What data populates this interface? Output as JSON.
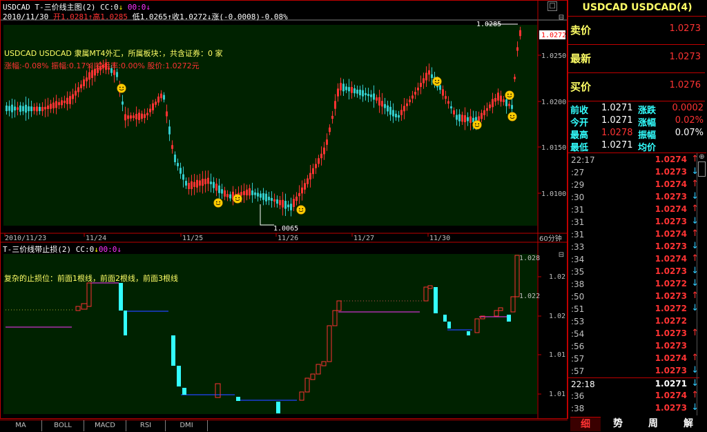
{
  "symbol_title": "USDCAD  USDCAD(4)",
  "main_chart": {
    "title": "USDCAD  T-三价线主图(2)",
    "cc_label": "CC:0",
    "cc_arrow": "↓",
    "cc_time": "00:0",
    "cc_time_arrow": "↓",
    "bar_info": {
      "date": "2010/11/30",
      "open": "开1.0281",
      "open_arrow": "↑",
      "high": "高1.0285",
      "low": "低1.0265",
      "low_arrow": "↑",
      "close": "收1.0272",
      "close_arrow": "↓",
      "change": "涨(-0.0008)-0.08%"
    },
    "info_line1": "USDCAD  USDCAD  隶属MT4外汇，所属板块：，共含证券：0 家",
    "info_line2": "涨幅:-0.08% 振幅:0.17% 换手率:0.00% 股价:1.0272元",
    "price_axis": [
      "1.0250",
      "1.0200",
      "1.0150",
      "1.0100"
    ],
    "current_price_label": "1.0272",
    "high_marker": "1.0285",
    "low_marker": "1.0065",
    "date_axis": [
      "2010/11/23",
      "11/24",
      "11/25",
      "11/26",
      "11/27",
      "11/30"
    ],
    "period_label": "60分钟"
  },
  "sub_chart": {
    "title": "T-三价线带止损(2)",
    "cc_label": "CC:0",
    "cc_arrow": "↓",
    "cc_time": "00:0",
    "cc_time_arrow": "↓",
    "info_line": "复杂的止损位：前面1根线，前面2根线，前面3根线",
    "axis_labels": [
      "1.028",
      "1.02",
      "1.022",
      "1.02",
      "1.01",
      "1.01"
    ]
  },
  "quote_panel": {
    "sell": {
      "label": "卖价",
      "value": "1.0273"
    },
    "last": {
      "label": "最新",
      "value": "1.0273"
    },
    "buy": {
      "label": "买价",
      "value": "1.0276"
    },
    "stats": [
      {
        "l1": "前收",
        "v1": "1.0271",
        "l2": "涨跌",
        "v2": "0.0002"
      },
      {
        "l1": "今开",
        "v1": "1.0271",
        "l2": "涨幅",
        "v2": "0.02%"
      },
      {
        "l1": "最高",
        "v1": "1.0278",
        "l2": "振幅",
        "v2": "0.07%"
      },
      {
        "l1": "最低",
        "v1": "1.0271",
        "l2": "均价",
        "v2": ""
      }
    ]
  },
  "ticks": [
    {
      "time": "22:17",
      "price": "1.0274",
      "dir": "up"
    },
    {
      "time": ":27",
      "price": "1.0273",
      "dir": "down"
    },
    {
      "time": ":29",
      "price": "1.0274",
      "dir": "up"
    },
    {
      "time": ":30",
      "price": "1.0273",
      "dir": "down"
    },
    {
      "time": ":31",
      "price": "1.0274",
      "dir": "up"
    },
    {
      "time": ":31",
      "price": "1.0273",
      "dir": "down"
    },
    {
      "time": ":31",
      "price": "1.0274",
      "dir": "up"
    },
    {
      "time": ":33",
      "price": "1.0273",
      "dir": "down"
    },
    {
      "time": ":34",
      "price": "1.0274",
      "dir": "up"
    },
    {
      "time": ":35",
      "price": "1.0273",
      "dir": "down"
    },
    {
      "time": ":38",
      "price": "1.0272",
      "dir": "down"
    },
    {
      "time": ":50",
      "price": "1.0273",
      "dir": "up"
    },
    {
      "time": ":51",
      "price": "1.0272",
      "dir": "down"
    },
    {
      "time": ":53",
      "price": "1.0272",
      "dir": ""
    },
    {
      "time": ":54",
      "price": "1.0273",
      "dir": "up"
    },
    {
      "time": ":56",
      "price": "1.0273",
      "dir": ""
    },
    {
      "time": ":57",
      "price": "1.0274",
      "dir": "up"
    },
    {
      "time": ":57",
      "price": "1.0273",
      "dir": "down"
    },
    {
      "time": "22:18",
      "price": "1.0271",
      "dir": "down",
      "white": true
    },
    {
      "time": ":36",
      "price": "1.0274",
      "dir": "up"
    },
    {
      "time": ":38",
      "price": "1.0273",
      "dir": "down"
    }
  ],
  "bottom_tabs": [
    "MA",
    "BOLL",
    "MACD",
    "RSI",
    "DMI"
  ],
  "side_tabs": [
    "细",
    "势",
    "周",
    "解"
  ],
  "colors": {
    "bg": "#000000",
    "chart_bg": "#002200",
    "up": "#ff3333",
    "down": "#33cccc",
    "frame": "#c00000"
  }
}
